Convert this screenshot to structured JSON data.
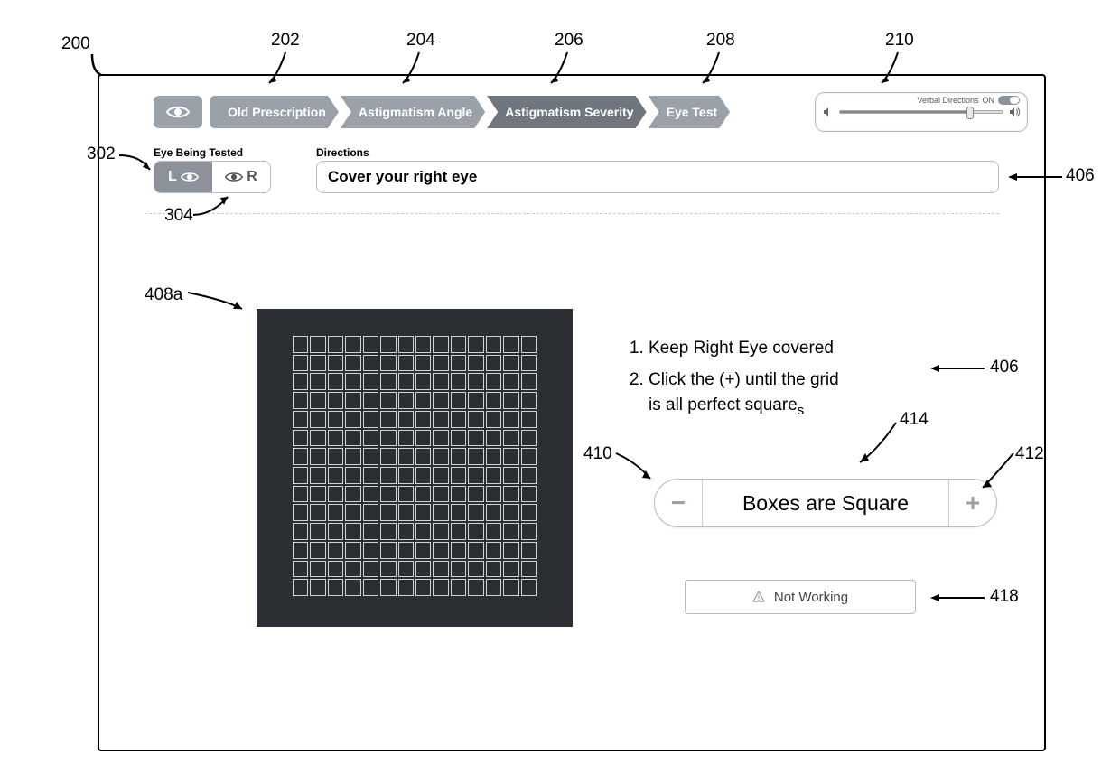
{
  "nav": {
    "steps": [
      {
        "label": "Old Prescription",
        "active": false
      },
      {
        "label": "Astigmatism Angle",
        "active": false
      },
      {
        "label": "Astigmatism Severity",
        "active": true
      },
      {
        "label": "Eye Test",
        "active": false
      }
    ]
  },
  "verbal": {
    "title": "Verbal Directions",
    "state": "ON"
  },
  "eyeTested": {
    "label": "Eye Being Tested",
    "left": "L",
    "right": "R"
  },
  "directions": {
    "label": "Directions",
    "text": "Cover your right eye"
  },
  "instructions": {
    "item1": "Keep Right Eye covered",
    "item2a": "Click the (+) until the grid",
    "item2b": "is all perfect square",
    "item2b_sub": "s"
  },
  "stepper": {
    "label": "Boxes are Square"
  },
  "notWorking": {
    "label": "Not Working"
  },
  "callouts": {
    "c200": "200",
    "c202": "202",
    "c204": "204",
    "c206": "206",
    "c208": "208",
    "c210": "210",
    "c302": "302",
    "c304": "304",
    "c406a": "406",
    "c408a": "408a",
    "c406b": "406",
    "c410": "410",
    "c412": "412",
    "c414": "414",
    "c418": "418"
  }
}
